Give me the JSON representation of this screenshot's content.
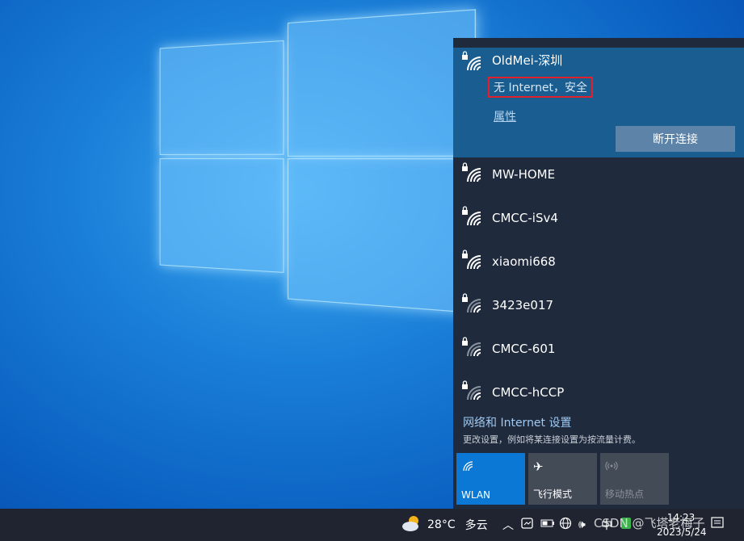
{
  "connected_network": {
    "name": "OldMei-深圳",
    "status": "无 Internet，安全",
    "properties_label": "属性",
    "disconnect_label": "断开连接"
  },
  "networks": [
    {
      "name": "MW-HOME",
      "secured": true,
      "signal": "full"
    },
    {
      "name": "CMCC-iSv4",
      "secured": true,
      "signal": "full"
    },
    {
      "name": "xiaomi668",
      "secured": true,
      "signal": "full"
    },
    {
      "name": "3423e017",
      "secured": true,
      "signal": "partial"
    },
    {
      "name": "CMCC-601",
      "secured": true,
      "signal": "partial"
    },
    {
      "name": "CMCC-hCCP",
      "secured": true,
      "signal": "partial"
    }
  ],
  "settings": {
    "link": "网络和 Internet 设置",
    "description": "更改设置，例如将某连接设置为按流量计费。"
  },
  "quick_actions": [
    {
      "label": "WLAN",
      "icon": "wifi-icon",
      "active": true
    },
    {
      "label": "飞行模式",
      "icon": "airplane-icon",
      "active": false
    },
    {
      "label": "移动热点",
      "icon": "hotspot-icon",
      "active": false,
      "disabled": true
    }
  ],
  "taskbar": {
    "weather_temp": "28°C",
    "weather_desc": "多云",
    "ime_label": "中",
    "time": "14:23",
    "date": "2023/5/24"
  },
  "watermark": "CSDN @飞塔老梅子",
  "colors": {
    "accent": "#0a78d4",
    "flyout_bg": "#1f2a3c",
    "connected_bg": "#195d91",
    "highlight_box": "#e0202a"
  }
}
